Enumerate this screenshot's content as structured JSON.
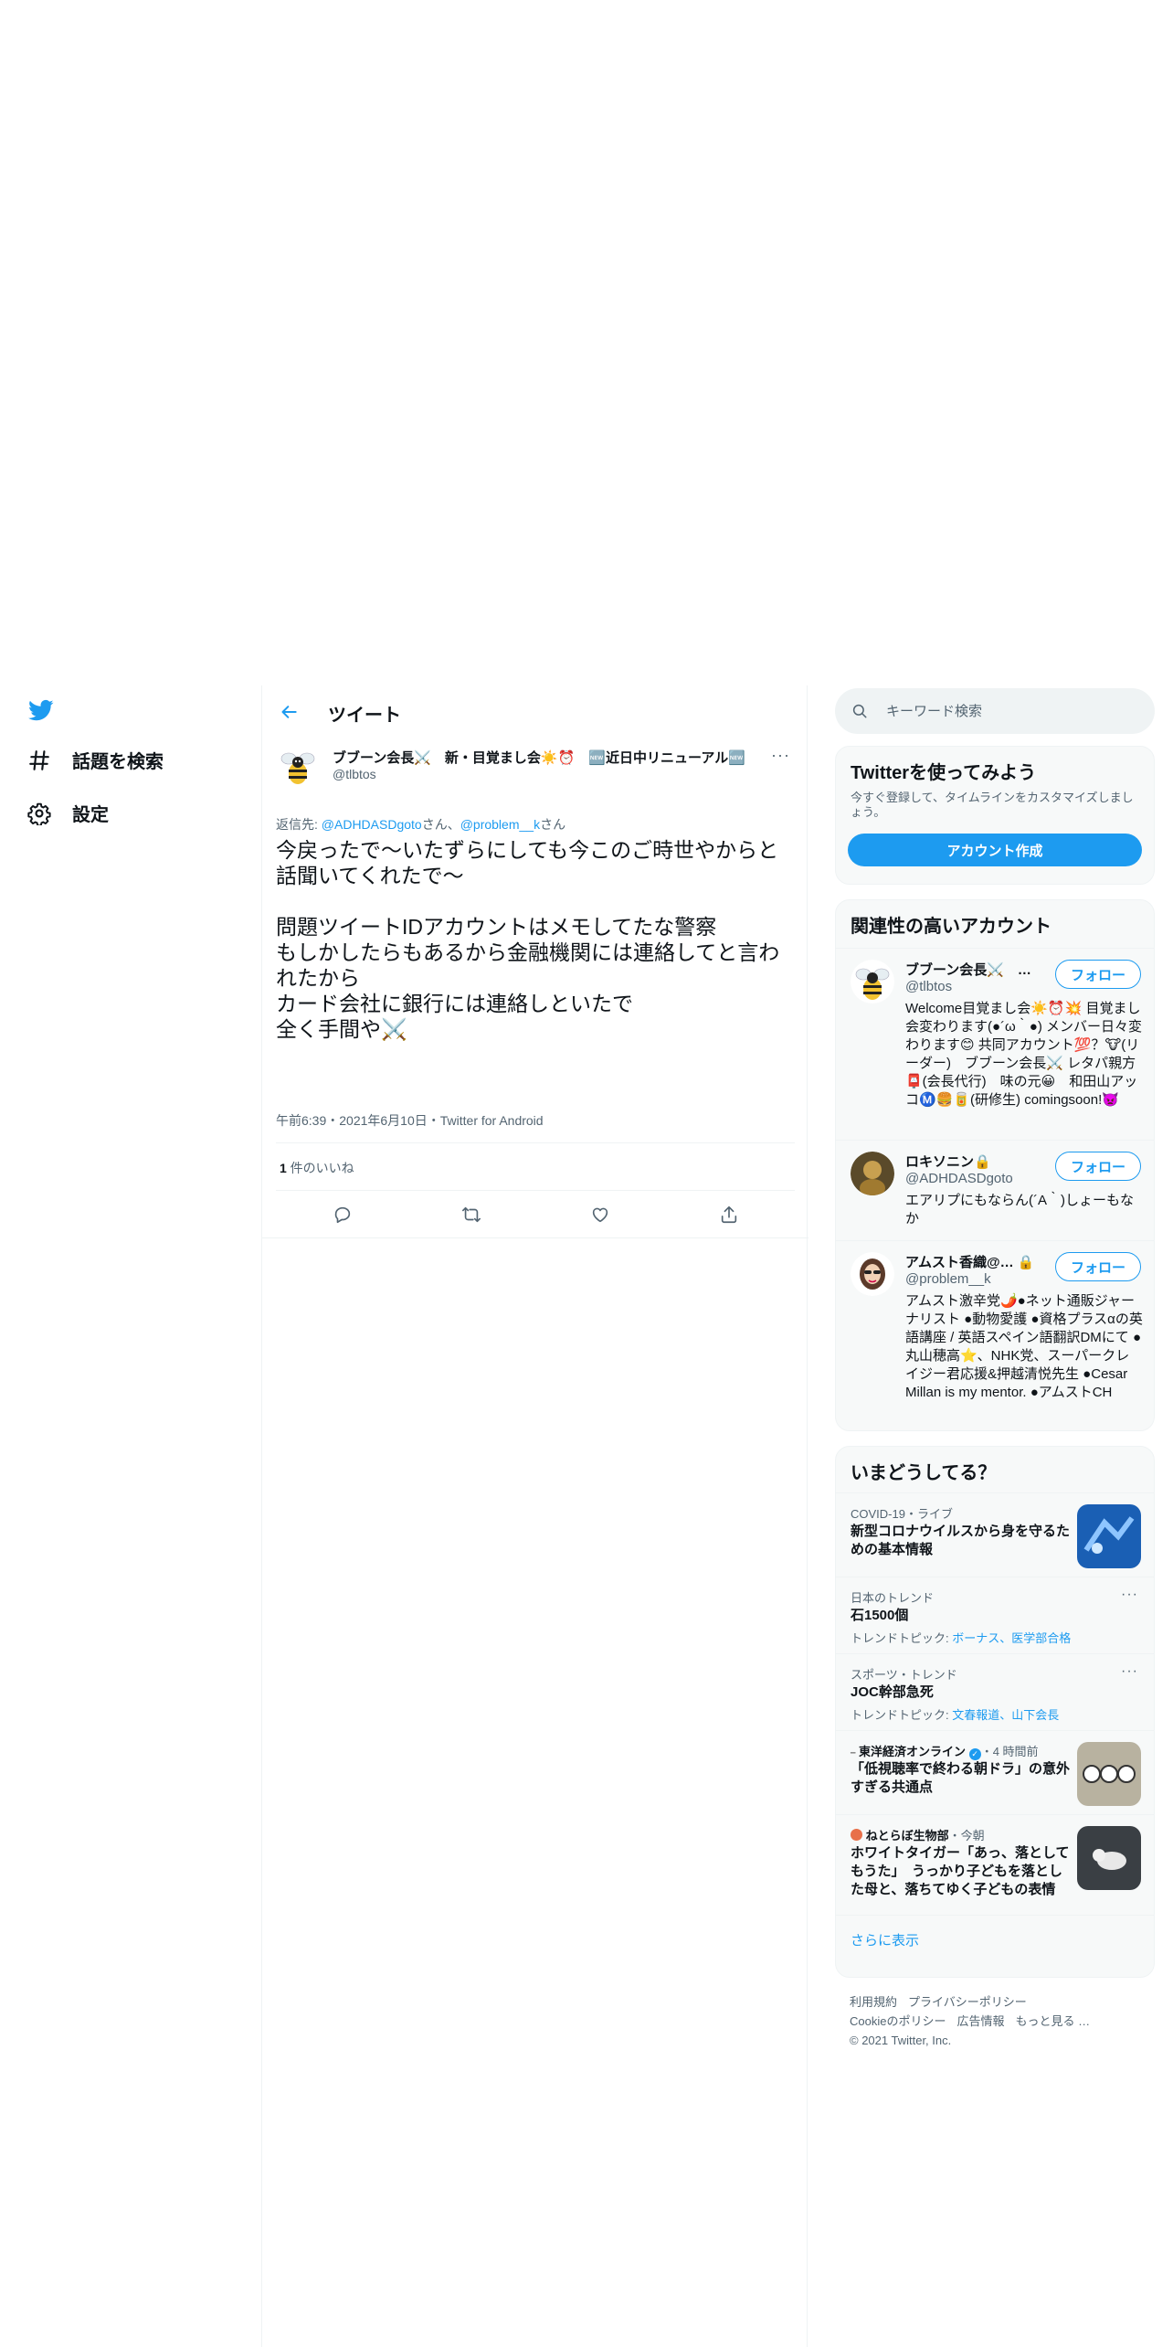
{
  "nav": {
    "items": [
      {
        "label": "話題を検索",
        "icon": "hash-icon"
      },
      {
        "label": "設定",
        "icon": "gear-icon"
      }
    ]
  },
  "header": {
    "title": "ツイート"
  },
  "tweet": {
    "author_name": "ブブーン会長⚔️　新・目覚まし会☀️⏰　🆕近日中リニューアル🆕",
    "author_handle": "@tlbtos",
    "reply_prefix": "返信先: ",
    "reply_user1": "@ADHDASDgoto",
    "reply_mid": "さん、",
    "reply_user2": "@problem__k",
    "reply_suffix": "さん",
    "text": "今戻ったで～いたずらにしても今このご時世やからと話聞いてくれたで～\n\n問題ツイートIDアカウントはメモしてたな警察\nもしかしたらもあるから金融機関には連絡してと言われたから\nカード会社に銀行には連絡しといたで\n全く手間や⚔️",
    "meta": "午前6:39・2021年6月10日・Twitter for Android",
    "like_count": "1",
    "like_label": " 件のいいね"
  },
  "search": {
    "placeholder": "キーワード検索"
  },
  "signup": {
    "title": "Twitterを使ってみよう",
    "desc": "今すぐ登録して、タイムラインをカスタマイズしましょう。",
    "button": "アカウント作成"
  },
  "related": {
    "title": "関連性の高いアカウント",
    "follow_label": "フォロー",
    "accounts": [
      {
        "name": "ブブーン会長⚔️　…",
        "handle": "@tlbtos",
        "bio": "Welcome目覚まし会☀️⏰💥 目覚まし会変わります(●´ω｀●) メンバー日々変わります😊 共同アカウント💯？🐮(リーダー)　ブブーン会長⚔️ レタパ親方📮(会長代行)　味の元😀　和田山アッコⓂ️🍔🥫(研修生) comingsoon!👿"
      },
      {
        "name": "ロキソニン🔒",
        "handle": "@ADHDASDgoto",
        "bio": "エアリプにもならん(´A｀)しょーもなか"
      },
      {
        "name": "アムスト香織@… 🔒",
        "handle": "@problem__k",
        "bio": "アムスト激辛党🌶️●ネット通販ジャーナリスト ●動物愛護 ●資格プラスαの英語講座 / 英語スペイン語翻訳DMにて ●丸山穂高⭐、NHK党、スーパークレイジー君応援&押越清悦先生 ●Cesar Millan is my mentor. ●アムストCH"
      }
    ]
  },
  "trends": {
    "title": "いまどうしてる？",
    "items": [
      {
        "context": "COVID-19・ライブ",
        "title": "新型コロナウイルスから身を守るための基本情報",
        "topics_prefix": "",
        "topics": ""
      },
      {
        "context": "日本のトレンド",
        "title": "石1500個",
        "topics_prefix": "トレンドトピック: ",
        "topics": "ボーナス、医学部合格"
      },
      {
        "context": "スポーツ・トレンド",
        "title": "JOC幹部急死",
        "topics_prefix": "トレンドトピック: ",
        "topics": "文春報道、山下会長"
      },
      {
        "context_source": "東洋経済オンライン",
        "context_time": "・4 時間前",
        "title": "「低視聴率で終わる朝ドラ」の意外すぎる共通点"
      },
      {
        "context_source": "ねとらぼ生物部",
        "context_time": "・今朝",
        "title": "ホワイトタイガー「あっ、落としてもうた」　うっかり子どもを落とした母と、落ちてゆく子どもの表情"
      }
    ],
    "show_more": "さらに表示"
  },
  "footer": {
    "terms": "利用規約",
    "privacy": "プライバシーポリシー",
    "cookie": "Cookieのポリシー",
    "ads": "広告情報",
    "more": "もっと見る …",
    "copyright": "© 2021 Twitter, Inc."
  },
  "colors": {
    "accent": "#1d9bf0",
    "text": "#0f1419",
    "secondary": "#536471",
    "border": "#eff3f4",
    "card_bg": "#f7f9f9"
  }
}
